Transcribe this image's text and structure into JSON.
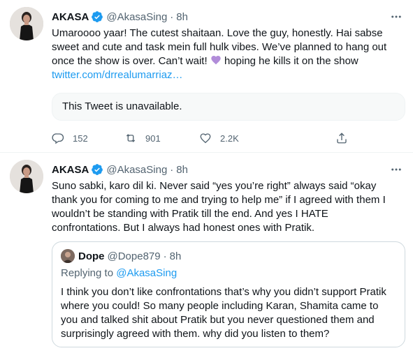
{
  "tweets": [
    {
      "author_name": "AKASA",
      "handle": "@AkasaSing",
      "separator": "·",
      "time": "8h",
      "text_lines": [
        "Umaroooo yaar! The cutest shaitaan. Love the guy, honestly. Hai sabse",
        "sweet and cute and task mein full hulk vibes. We’ve planned to hang out",
        "once the show is over. Can’t wait!",
        "hoping he kills it on the show"
      ],
      "link": "twitter.com/drrealumarriaz…",
      "unavailable_text": "This Tweet is unavailable.",
      "reply_count": "152",
      "retweet_count": "901",
      "like_count": "2.2K"
    },
    {
      "author_name": "AKASA",
      "handle": "@AkasaSing",
      "separator": "·",
      "time": "8h",
      "text_lines": [
        "Suno sabki, karo dil ki. Never said “yes you’re right” always said “okay",
        "thank you for coming to me and trying to help me” if I agreed with them I",
        "wouldn’t be standing with Pratik till the end. And yes I HATE",
        "confrontations. But I always had honest ones with Pratik."
      ],
      "quote": {
        "author_name": "Dope",
        "handle": "@Dope879",
        "separator": "·",
        "time": "8h",
        "replying_prefix": "Replying to ",
        "replying_handle": "@AkasaSing",
        "text_lines": [
          "I think you don’t like confrontations that’s why you didn’t support Pratik",
          "where you could! So many people including Karan, Shamita came to",
          "you and talked shit about Pratik but you never questioned them and",
          "surprisingly agreed with them.  why did you listen to them?"
        ]
      }
    }
  ],
  "colors": {
    "accent": "#1d9bf0",
    "secondary_text": "#536471",
    "heart_emoji": "#b18cd9"
  },
  "icons": [
    "verified-badge-icon",
    "more-options-icon",
    "reply-icon",
    "retweet-icon",
    "like-icon",
    "share-icon",
    "purple-heart-emoji"
  ]
}
